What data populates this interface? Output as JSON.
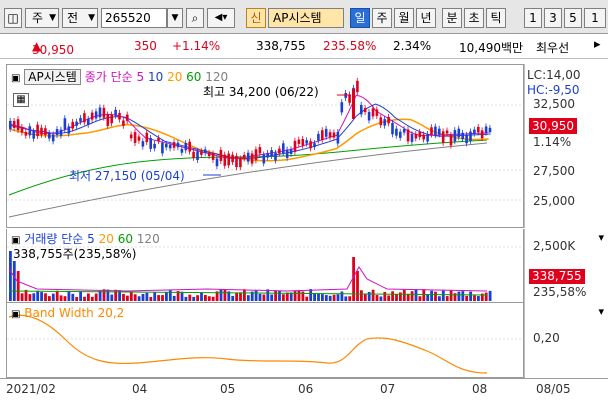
{
  "toolbar": {
    "period_button": "주",
    "prev_label": "전",
    "code_value": "265520",
    "new_badge": "신",
    "stock_name": "AP시스템",
    "periods": [
      "일",
      "주",
      "월",
      "년",
      "분",
      "초",
      "틱"
    ],
    "intervals": [
      "1",
      "3",
      "5",
      "1"
    ]
  },
  "quote": {
    "price": "30,950",
    "change": "350",
    "change_pct": "+1.14%",
    "volume": "338,755",
    "volume_ratio": "235.58%",
    "turnover_ratio": "2.34%",
    "amount": "10,490백만",
    "best_label": "최우선"
  },
  "price_panel": {
    "title_stock": "AP시스템",
    "title_ma": "종가 단순 5",
    "ma_periods": [
      "10",
      "20",
      "60",
      "120"
    ],
    "high_note": "최고 34,200 (06/22)",
    "low_note": "최저 27,150 (05/04)",
    "lc": "LC:14,00",
    "hc": "HC:-9,50",
    "y_labels": [
      "32,500",
      "27,500",
      "25,000"
    ],
    "last_price": "30,950",
    "last_pct": "1.14%"
  },
  "volume_panel": {
    "title": "거래량 단순 5",
    "ma_periods": [
      "20",
      "60",
      "120"
    ],
    "sub": "338,755주(235,58%)",
    "y_label": "2,500K",
    "last_vol": "338,755",
    "last_pct": "235,58%"
  },
  "bw_panel": {
    "title": "Band Width 20,2",
    "y_label": "0,20"
  },
  "xaxis": {
    "labels": [
      "2021/02",
      "04",
      "05",
      "06",
      "07",
      "08"
    ],
    "date_label": "08/05"
  },
  "colors": {
    "up": "#e0001b",
    "down": "#1a3fd1",
    "ma5": "#d010c0",
    "ma10": "#1a3fd1",
    "ma20": "#ff9900",
    "ma60": "#00a000",
    "ma120": "#808080",
    "bw": "#ff8800"
  }
}
